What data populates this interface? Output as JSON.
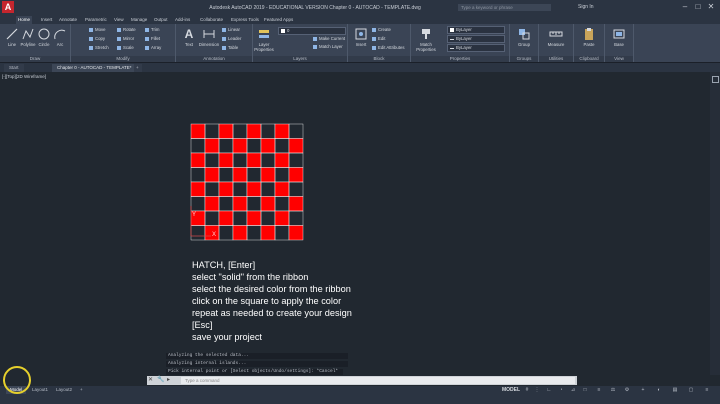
{
  "app": {
    "logo": "A",
    "title": "Autodesk AutoCAD 2019 - EDUCATIONAL VERSION    Chapter 0 - AUTOCAD - TEMPLATE.dwg",
    "search_placeholder": "Type a keyword or phrase",
    "signin": "Sign In"
  },
  "ribbon_tabs": [
    "Home",
    "Insert",
    "Annotate",
    "Parametric",
    "View",
    "Manage",
    "Output",
    "Add-ins",
    "Collaborate",
    "Express Tools",
    "Featured Apps"
  ],
  "ribbon": {
    "draw": {
      "label": "Draw",
      "tools": [
        "Line",
        "Polyline",
        "Circle",
        "Arc"
      ]
    },
    "modify": {
      "label": "Modify",
      "tools": [
        "Move",
        "Rotate",
        "Trim",
        "Copy",
        "Mirror",
        "Fillet",
        "Stretch",
        "Scale",
        "Array"
      ]
    },
    "annotation": {
      "label": "Annotation",
      "tools": [
        "Text",
        "Dimension",
        "Linear",
        "Leader",
        "Table"
      ]
    },
    "layers": {
      "label": "Layers",
      "tools": [
        "Layer Properties",
        "Make Current",
        "Match Layer"
      ]
    },
    "block": {
      "label": "Block",
      "tools": [
        "Insert",
        "Create",
        "Edit",
        "Edit Attributes"
      ]
    },
    "properties": {
      "label": "Properties",
      "tools": [
        "Match Properties"
      ],
      "dropdowns": [
        "ByLayer",
        "ByLayer",
        "ByLayer"
      ]
    },
    "groups": {
      "label": "Groups",
      "tools": [
        "Group"
      ]
    },
    "utilities": {
      "label": "Utilities",
      "tools": [
        "Measure"
      ]
    },
    "clipboard": {
      "label": "Clipboard",
      "tools": [
        "Paste"
      ]
    },
    "view": {
      "label": "View",
      "tools": [
        "Base"
      ]
    }
  },
  "doc_tabs": [
    "Start",
    "Chapter 0 - AUTOCAD - TEMPLATE*"
  ],
  "viewport": {
    "label": "[-][Top][2D Wireframe]",
    "hatch_color": "#ff0000",
    "grid_columns": 8,
    "grid_rows": 8
  },
  "instructions": [
    "HATCH, [Enter]",
    "select \"solid\" from the ribbon",
    "select the desired color from the ribbon",
    "click on the square to apply the color",
    "repeat as needed to create your design",
    "[Esc]",
    "save your project"
  ],
  "command_history": [
    "Analyzing the selected data...",
    "Analyzing internal islands...",
    "Pick internal point or [Select objects/Undo/settings]: *Cancel*"
  ],
  "command_placeholder": "Type a command",
  "layout_tabs": [
    "Model",
    "Layout1",
    "Layout2"
  ],
  "status": {
    "model": "MODEL"
  }
}
